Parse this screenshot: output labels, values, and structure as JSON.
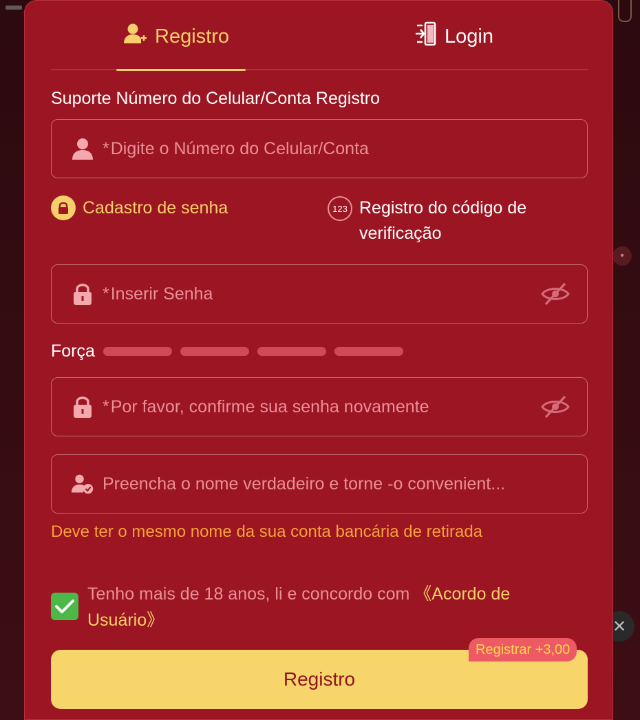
{
  "tabs": {
    "register_label": "Registro",
    "login_label": "Login"
  },
  "form": {
    "support_label": "Suporte Número do Celular/Conta Registro",
    "account_placeholder": "Digite o Número do Celular/Conta",
    "required_mark": "*",
    "options": {
      "password_label": "Cadastro de senha",
      "code_label": "Registro do código de verificação",
      "code_badge": "123"
    },
    "password_placeholder": "Inserir Senha",
    "strength_label": "Força",
    "strength_level": 0,
    "strength_segments": 4,
    "confirm_placeholder": "Por favor, confirme sua senha novamente",
    "realname_placeholder": "Preencha o nome verdadeiro e torne -o convenient...",
    "realname_warning": "Deve ter o mesmo nome da sua conta bancária de retirada",
    "agree_text": "Tenho mais de 18 anos, li e concordo com ",
    "agree_link": "《Acordo de Usuário》",
    "agree_checked": true,
    "submit_label": "Registro",
    "bonus_badge": "Registrar +3,00"
  },
  "colors": {
    "modal_bg": "#9b1522",
    "accent_gold": "#f6cf6a",
    "placeholder_pink": "#ea8f98",
    "warning_orange": "#f5a23a",
    "checkbox_green": "#4cb848",
    "button_yellow": "#f7d56a"
  }
}
